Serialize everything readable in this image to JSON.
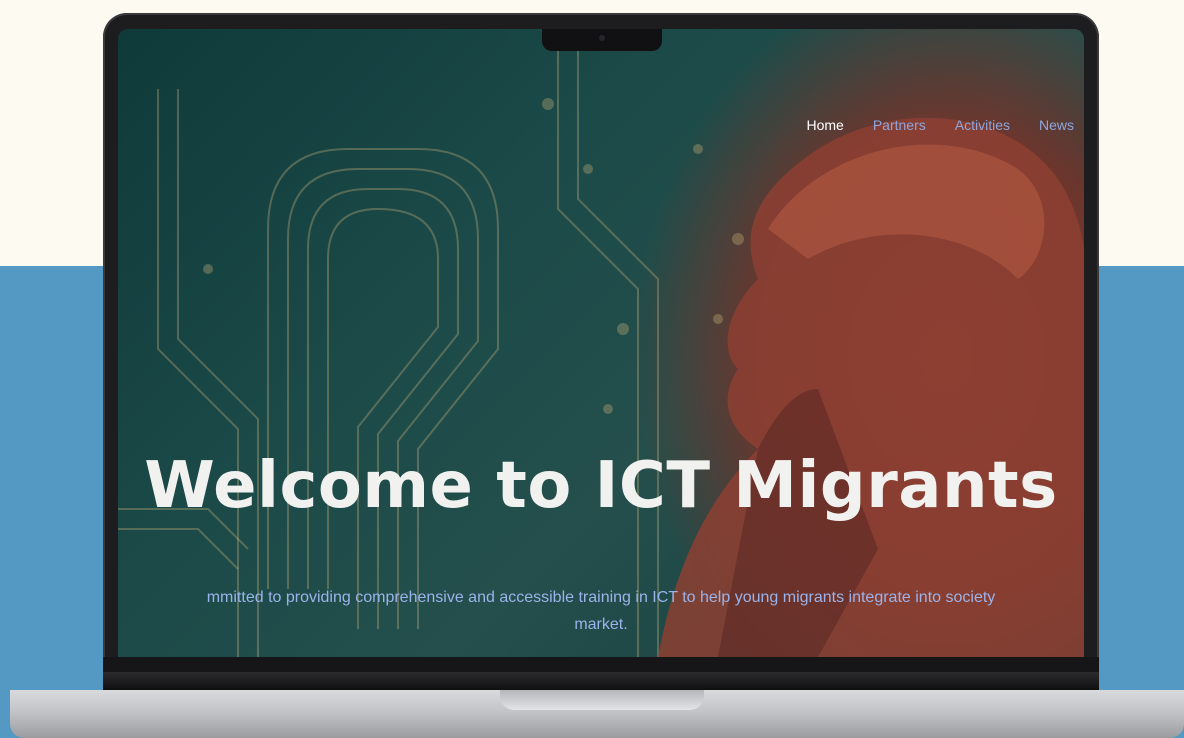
{
  "nav": {
    "items": [
      {
        "label": "Home",
        "active": true
      },
      {
        "label": "Partners",
        "active": false
      },
      {
        "label": "Activities",
        "active": false
      },
      {
        "label": "News",
        "active": false
      }
    ]
  },
  "hero": {
    "title": "Welcome to ICT Migrants",
    "subtitle_line1": "mmitted to providing comprehensive and accessible training in ICT to help young migrants integrate into society",
    "subtitle_line2": "market."
  },
  "colors": {
    "page_background": "#fdfaf2",
    "band": "#5499c4",
    "nav_link": "#8ea6dd",
    "nav_active": "#ffffff",
    "hero_title": "#f1f1ef",
    "hero_subtitle": "#9ab3ea"
  }
}
